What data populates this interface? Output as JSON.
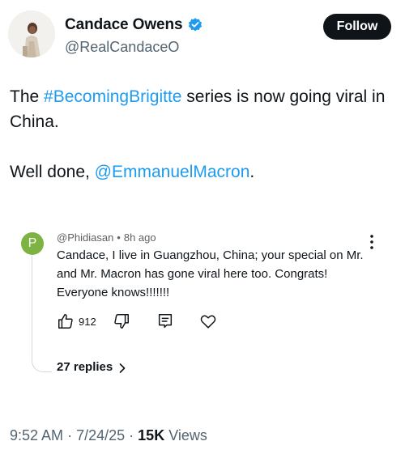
{
  "author": {
    "name": "Candace Owens",
    "handle": "@RealCandaceO",
    "verified_color": "#1d9bf0"
  },
  "follow_button": {
    "label": "Follow"
  },
  "tweet": {
    "line1_prefix": "The ",
    "hashtag": "#BecomingBrigitte",
    "line1_suffix": " series is now going viral in China.",
    "line2_prefix": "Well done, ",
    "mention": "@EmmanuelMacron",
    "line2_suffix": "."
  },
  "embedded_reply": {
    "avatar_letter": "P",
    "avatar_color": "#7cb342",
    "username": "@Phidiasan",
    "separator": "•",
    "time_ago": "8h ago",
    "text": "Candace, I live in Guangzhou, China;  your special on Mr. and Mr. Macron has gone viral here too.  Congrats! Everyone knows!!!!!!!",
    "like_count": "912",
    "replies_label": "27 replies"
  },
  "meta": {
    "time": "9:52 AM",
    "date": "7/24/25",
    "separator": "·",
    "views_count": "15K",
    "views_label": "Views"
  },
  "icons": [
    "verified-badge-icon",
    "more-vertical-icon",
    "thumbs-up-icon",
    "thumbs-down-icon",
    "comment-icon",
    "heart-icon",
    "chevron-right-icon"
  ]
}
